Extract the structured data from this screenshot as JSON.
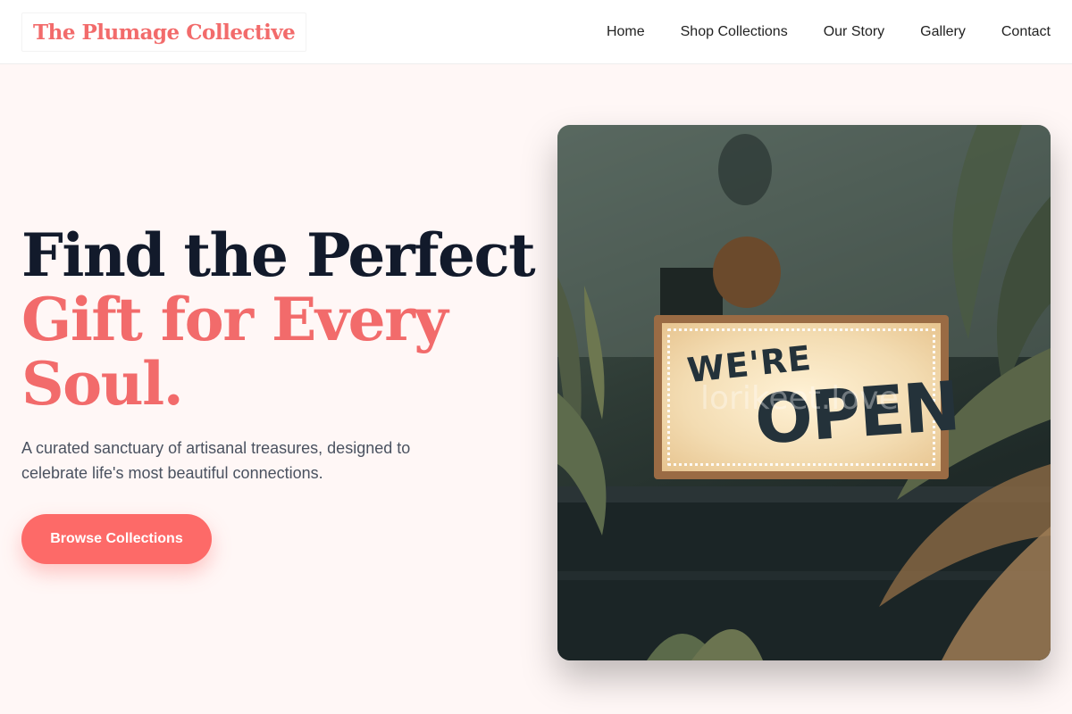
{
  "brand": {
    "name": "The Plumage Collective"
  },
  "nav": {
    "items": [
      "Home",
      "Shop Collections",
      "Our Story",
      "Gallery",
      "Contact"
    ]
  },
  "hero": {
    "line1": "Find the Perfect",
    "line2": "Gift for Every",
    "line3": "Soul.",
    "subtitle": "A curated sanctuary of artisanal treasures, designed to celebrate life's most beautiful connections.",
    "cta_label": "Browse Collections"
  },
  "photo": {
    "sign_word1": "WE'RE",
    "sign_word2": "OPEN",
    "watermark": "lorikeet.love"
  },
  "colors": {
    "accent": "#fd6a68",
    "brand": "#f26b6b",
    "heading": "#121a2b",
    "background": "#fff7f6"
  }
}
